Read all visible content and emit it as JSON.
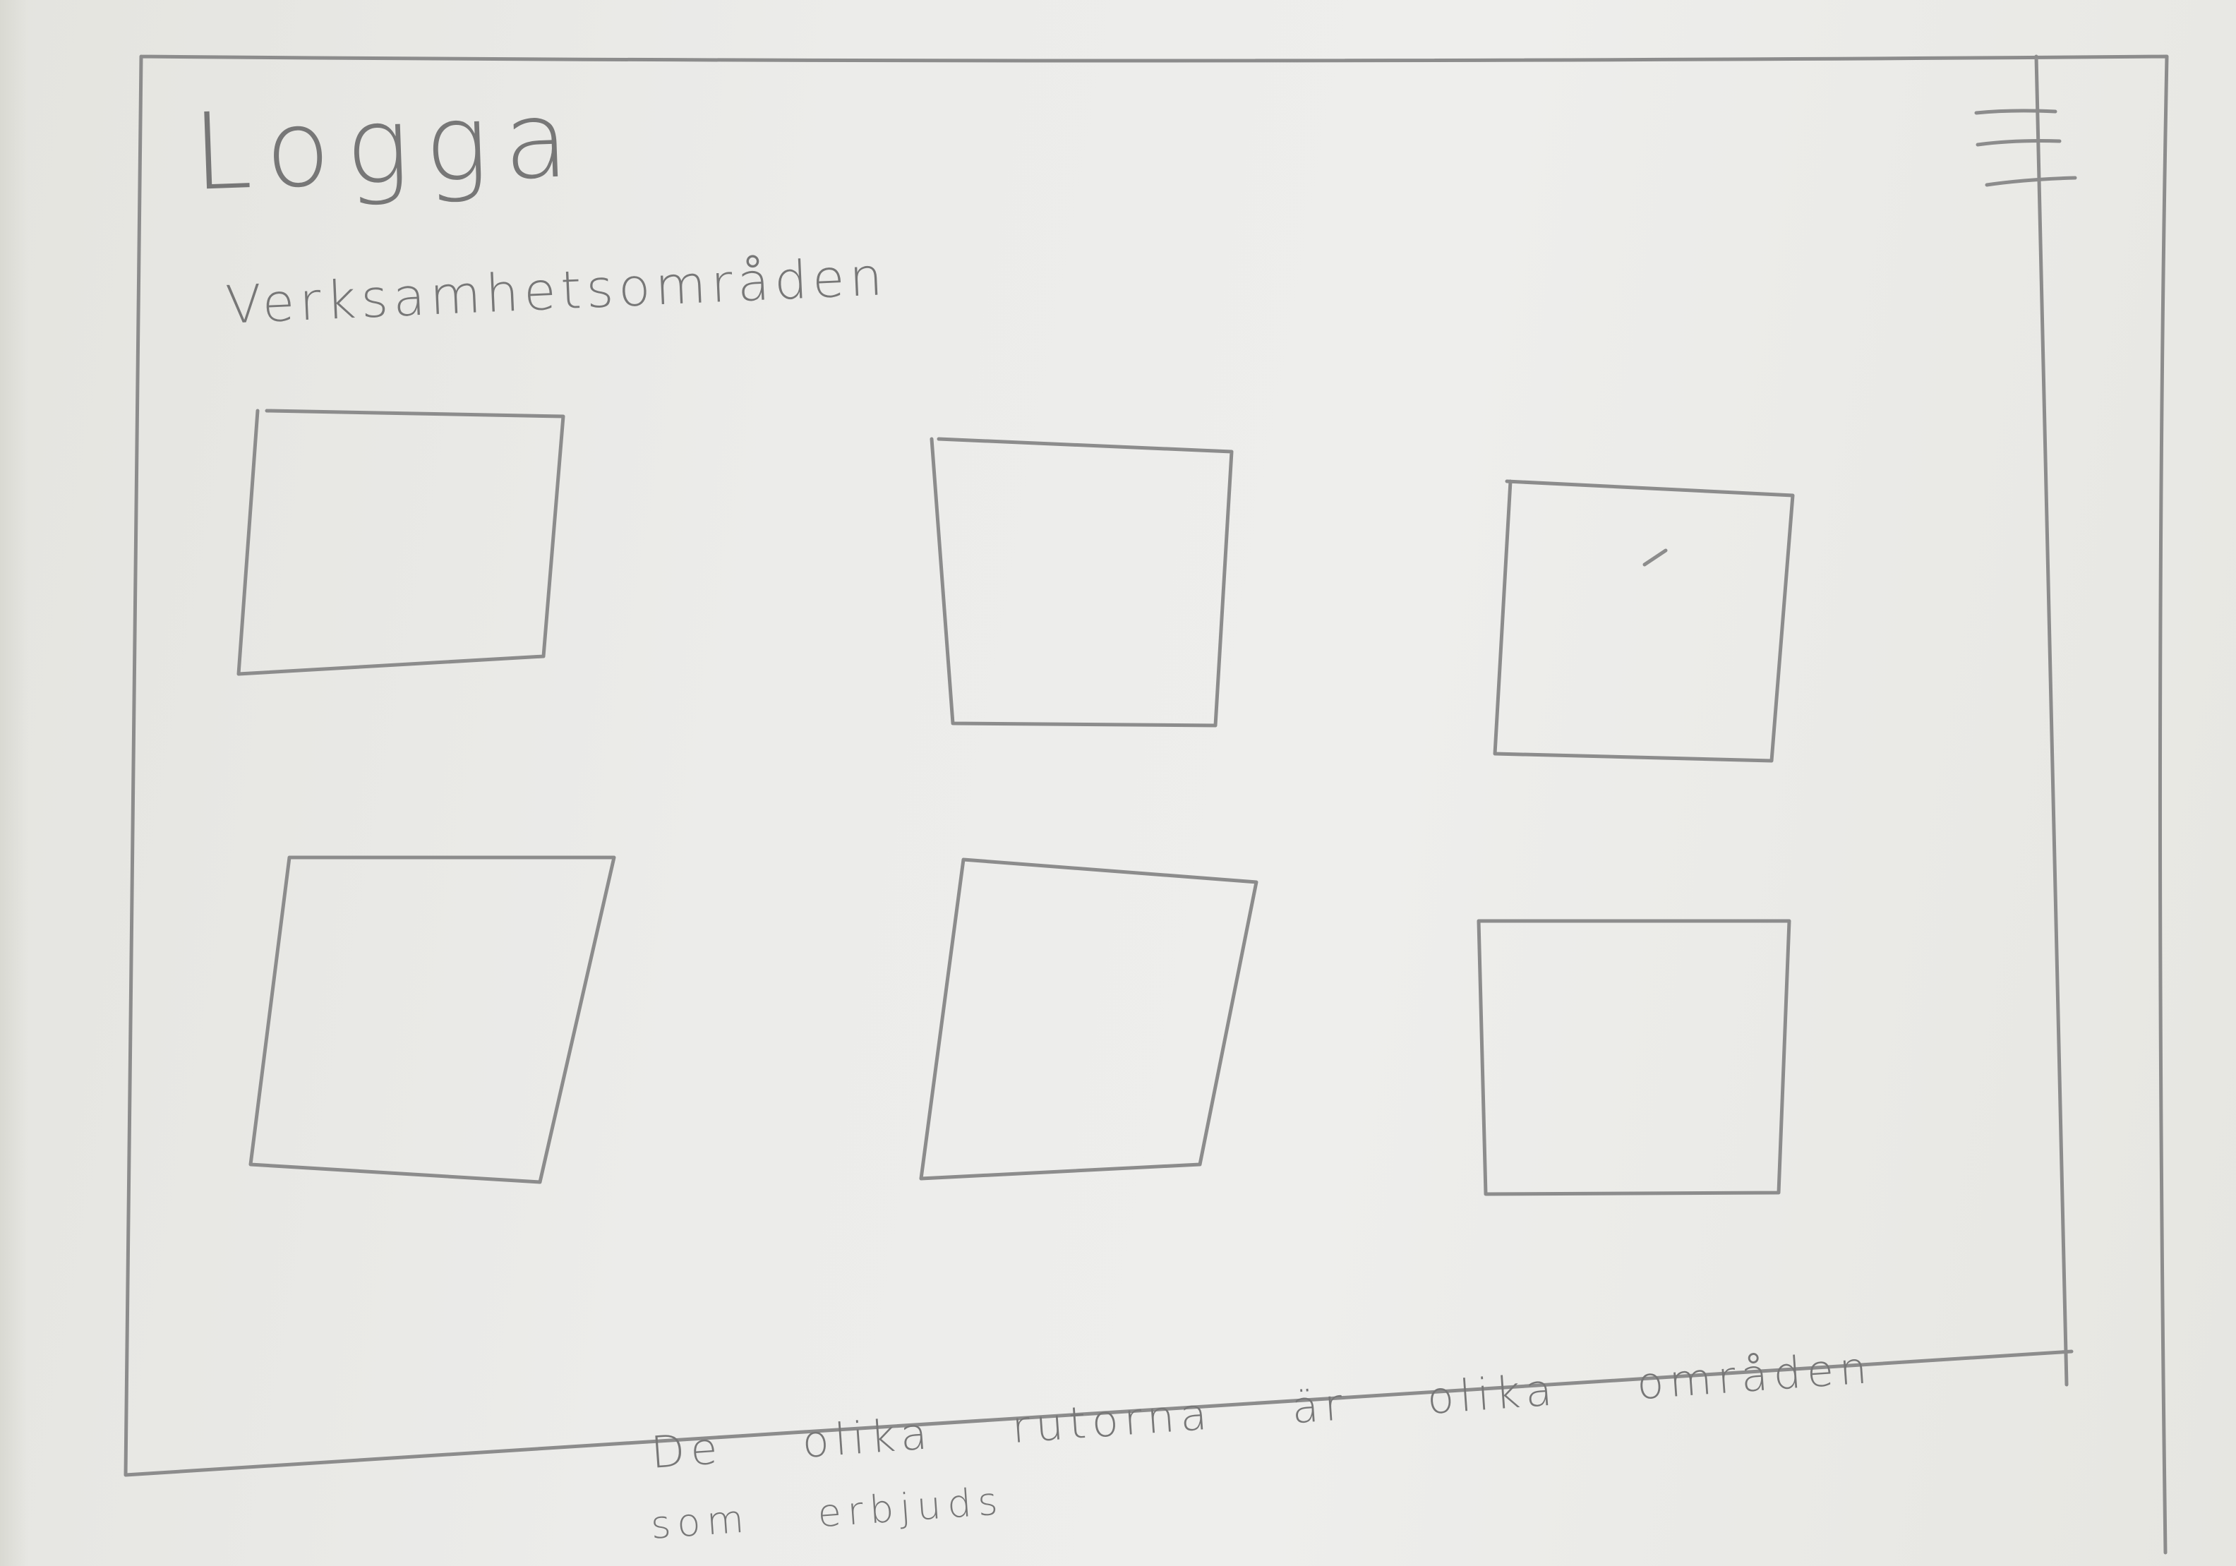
{
  "header": {
    "logo_text": "Logga",
    "menu_icon": "hamburger-menu-icon"
  },
  "main": {
    "section_title": "Verksamhetsområden",
    "tiles_count_note": "6 placeholder tiles in 2 rows of 3"
  },
  "annotation": {
    "line_1": "De olika rutorna är olika områden",
    "line_2": "som erbjuds"
  },
  "colors": {
    "paper": "#ececea",
    "pencil": "#8c8c8c"
  }
}
